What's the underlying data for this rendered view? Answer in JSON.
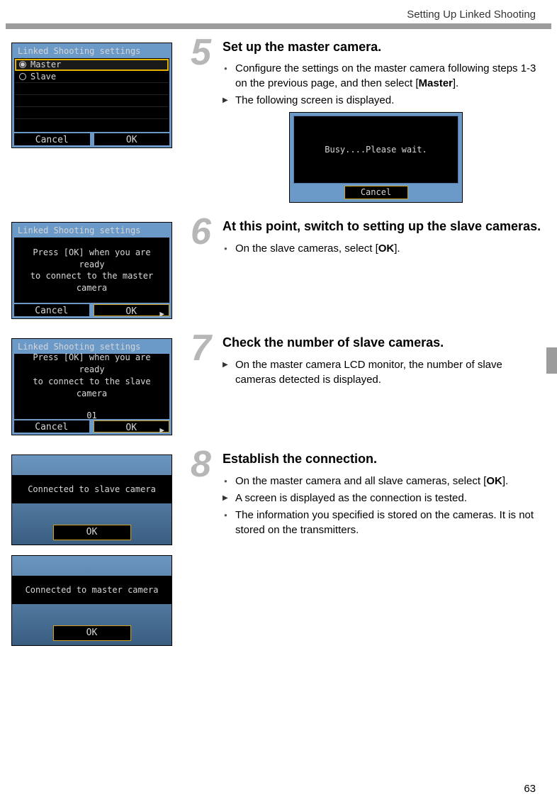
{
  "header": {
    "title": "Setting Up Linked Shooting"
  },
  "page_number": "63",
  "steps": {
    "s5": {
      "num": "5",
      "title": "Set up the master camera.",
      "b1_pre": "Configure the settings on the master camera following steps 1-3 on the previous page, and then select [",
      "b1_bold": "Master",
      "b1_post": "].",
      "b2": "The following screen is displayed."
    },
    "s6": {
      "num": "6",
      "title": "At this point, switch to setting up the slave cameras.",
      "b1_pre": "On the slave cameras, select [",
      "b1_bold": "OK",
      "b1_post": "]."
    },
    "s7": {
      "num": "7",
      "title": "Check the number of slave cameras.",
      "b1": "On the master camera LCD monitor, the number of slave cameras detected is displayed."
    },
    "s8": {
      "num": "8",
      "title": "Establish the connection.",
      "b1_pre": "On the master camera and all slave cameras, select [",
      "b1_bold": "OK",
      "b1_post": "].",
      "b2": "A screen is displayed as the connection is tested.",
      "b3": "The information you specified is stored on the cameras. It is not stored on the transmitters."
    }
  },
  "lcd": {
    "linked_title": "Linked Shooting settings",
    "master": "Master",
    "slave": "Slave",
    "cancel": "Cancel",
    "ok": "OK",
    "busy": "Busy....Please wait.",
    "msg6a": "Press [OK] when you are ready",
    "msg6b": "to connect to the master camera",
    "msg7a": "Press [OK] when you are ready",
    "msg7b": "to connect to the slave camera",
    "count": "01",
    "conn_slave": "Connected to slave camera",
    "conn_master": "Connected to master camera"
  }
}
